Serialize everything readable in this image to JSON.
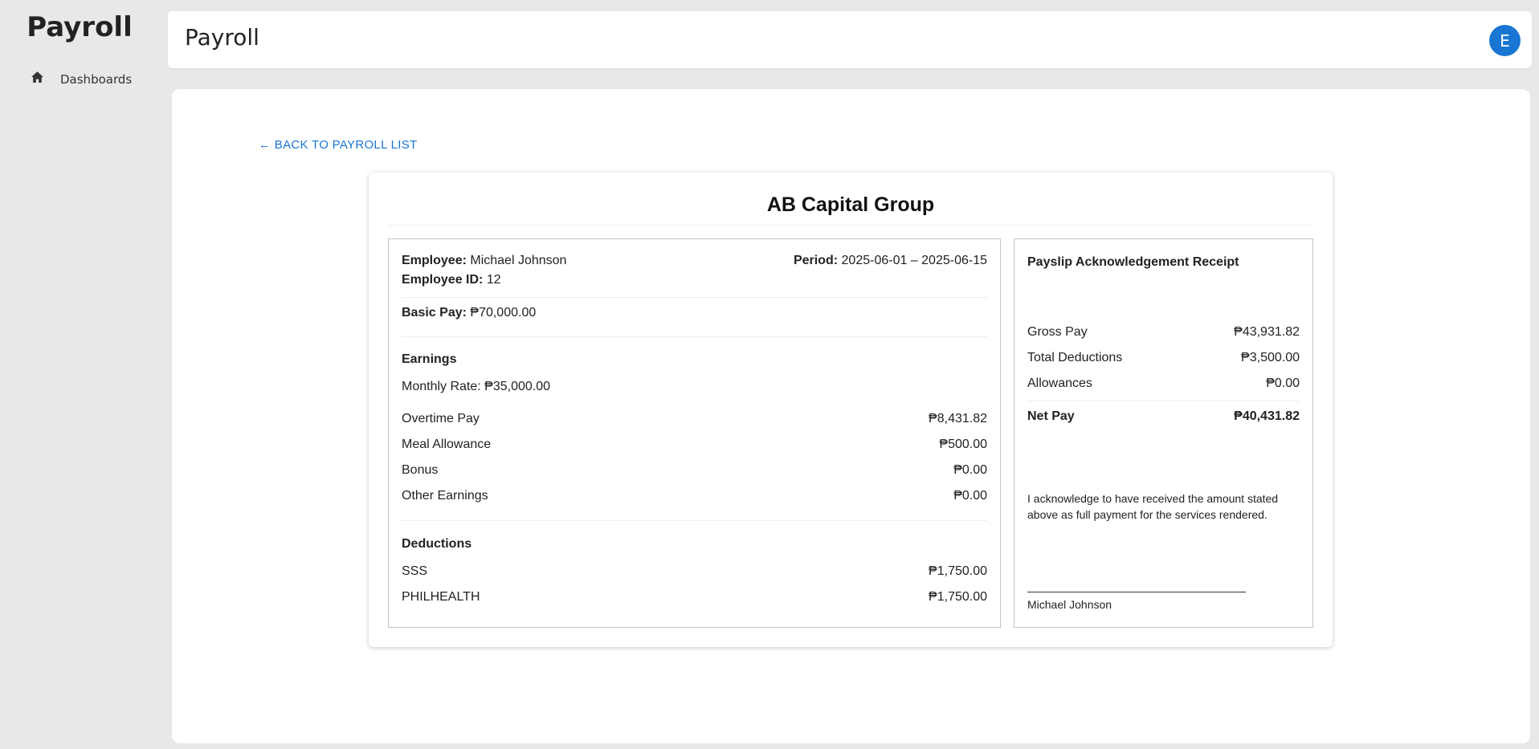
{
  "app": {
    "brand": "Payroll",
    "page_title": "Payroll",
    "avatar_initial": "E"
  },
  "sidebar": {
    "items": [
      {
        "label": "Dashboards",
        "icon": "home-icon"
      }
    ]
  },
  "back_link": "← BACK TO PAYROLL LIST",
  "payslip": {
    "company": "AB Capital Group",
    "employee_label": "Employee:",
    "employee_name": "Michael Johnson",
    "employee_id_label": "Employee ID:",
    "employee_id": "12",
    "period_label": "Period:",
    "period": "2025-06-01 – 2025-06-15",
    "basic_pay_label": "Basic Pay:",
    "basic_pay": "₱70,000.00",
    "earnings_heading": "Earnings",
    "monthly_rate": "Monthly Rate: ₱35,000.00",
    "earnings": [
      {
        "label": "Overtime Pay",
        "value": "₱8,431.82"
      },
      {
        "label": "Meal Allowance",
        "value": "₱500.00"
      },
      {
        "label": "Bonus",
        "value": "₱0.00"
      },
      {
        "label": "Other Earnings",
        "value": "₱0.00"
      }
    ],
    "deductions_heading": "Deductions",
    "deductions": [
      {
        "label": "SSS",
        "value": "₱1,750.00"
      },
      {
        "label": "PHILHEALTH",
        "value": "₱1,750.00"
      }
    ]
  },
  "receipt": {
    "title": "Payslip Acknowledgement Receipt",
    "gross_pay_label": "Gross Pay",
    "gross_pay": "₱43,931.82",
    "total_deductions_label": "Total Deductions",
    "total_deductions": "₱3,500.00",
    "allowances_label": "Allowances",
    "allowances": "₱0.00",
    "net_pay_label": "Net Pay",
    "net_pay": "₱40,431.82",
    "acknowledgement": "I acknowledge to have received the amount stated above as full payment for the services rendered.",
    "signatory": "Michael Johnson"
  },
  "colors": {
    "accent": "#1976d2",
    "background": "#e8e8ea"
  }
}
